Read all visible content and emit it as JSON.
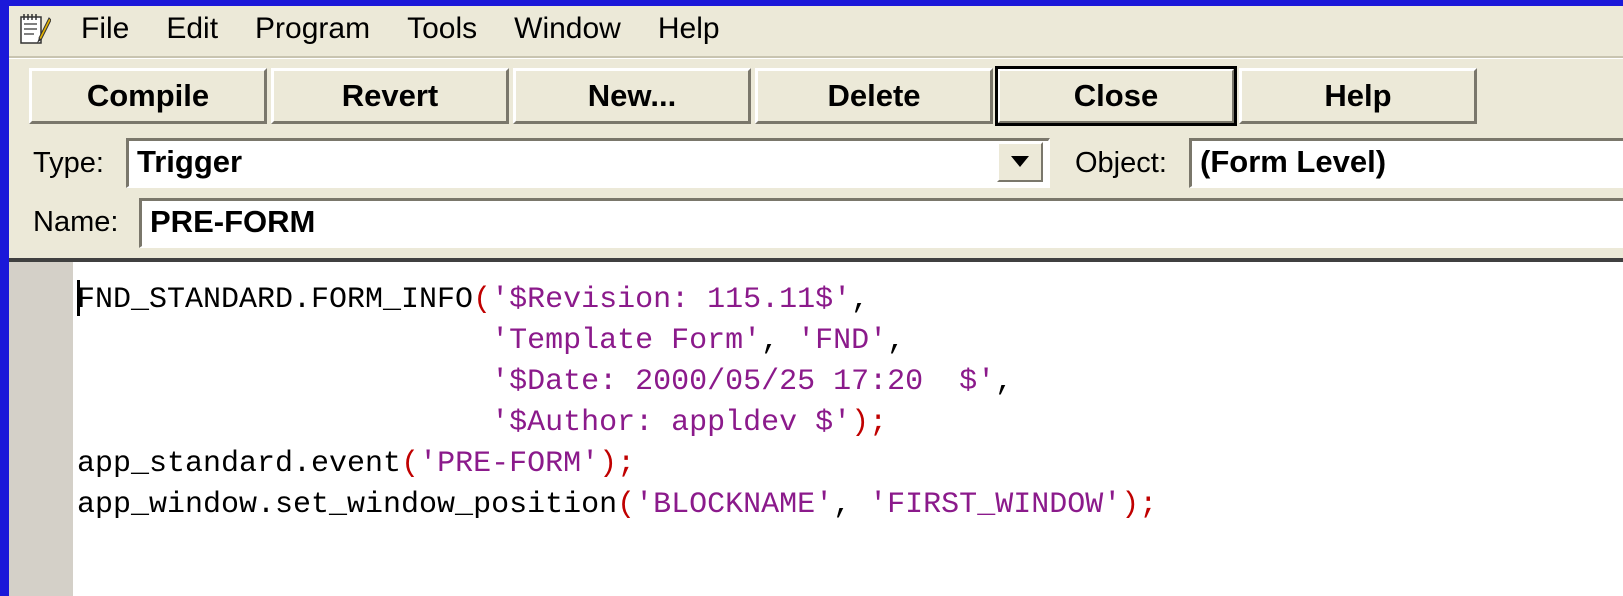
{
  "menu": [
    "File",
    "Edit",
    "Program",
    "Tools",
    "Window",
    "Help"
  ],
  "toolbar": {
    "compile": "Compile",
    "revert": "Revert",
    "new": "New...",
    "delete": "Delete",
    "close": "Close",
    "help": "Help"
  },
  "type_field": {
    "label": "Type:",
    "value": "Trigger"
  },
  "object_field": {
    "label": "Object:",
    "value": "(Form Level)"
  },
  "name_field": {
    "label": "Name:",
    "value": "PRE-FORM"
  },
  "code_lines": [
    [
      {
        "t": "FND_STANDARD.FORM_INFO",
        "c": ""
      },
      {
        "t": "(",
        "c": "pun"
      },
      {
        "t": "'$Revision: 115.11$'",
        "c": "str"
      },
      {
        "t": ",",
        "c": ""
      }
    ],
    [
      {
        "t": "                       ",
        "c": ""
      },
      {
        "t": "'Template Form'",
        "c": "str"
      },
      {
        "t": ", ",
        "c": ""
      },
      {
        "t": "'FND'",
        "c": "str"
      },
      {
        "t": ",",
        "c": ""
      }
    ],
    [
      {
        "t": "                       ",
        "c": ""
      },
      {
        "t": "'$Date: 2000/05/25 17:20  $'",
        "c": "str"
      },
      {
        "t": ",",
        "c": ""
      }
    ],
    [
      {
        "t": "                       ",
        "c": ""
      },
      {
        "t": "'$Author: appldev $'",
        "c": "str"
      },
      {
        "t": ");",
        "c": "pun"
      }
    ],
    [
      {
        "t": "app_standard.event",
        "c": ""
      },
      {
        "t": "(",
        "c": "pun"
      },
      {
        "t": "'PRE-FORM'",
        "c": "str"
      },
      {
        "t": ");",
        "c": "pun"
      }
    ],
    [
      {
        "t": "app_window.set_window_position",
        "c": ""
      },
      {
        "t": "(",
        "c": "pun"
      },
      {
        "t": "'BLOCKNAME'",
        "c": "str"
      },
      {
        "t": ", ",
        "c": ""
      },
      {
        "t": "'FIRST_WINDOW'",
        "c": "str"
      },
      {
        "t": ");",
        "c": "pun"
      }
    ]
  ]
}
